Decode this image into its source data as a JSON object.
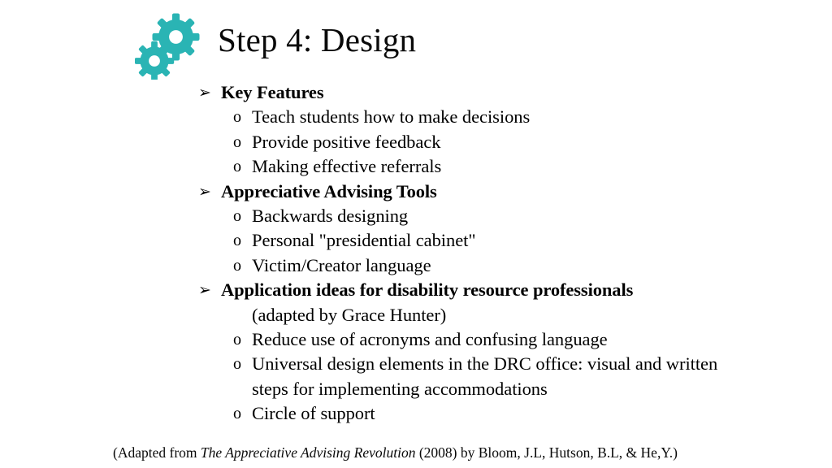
{
  "slide": {
    "background_color": "#ffffff",
    "text_color": "#000000",
    "accent_color": "#2ab4b4",
    "title": "Step 4: Design",
    "icon_name": "gears-icon"
  },
  "bullets": {
    "level1_glyph": "➢",
    "level2_glyph": "o"
  },
  "content": [
    {
      "level": 1,
      "text": "Key Features"
    },
    {
      "level": 2,
      "text": "Teach students how to make decisions"
    },
    {
      "level": 2,
      "text": "Provide positive feedback"
    },
    {
      "level": 2,
      "text": "Making effective referrals"
    },
    {
      "level": 1,
      "text": "Appreciative Advising Tools"
    },
    {
      "level": 2,
      "text": "Backwards designing"
    },
    {
      "level": 2,
      "text": "Personal \"presidential cabinet\""
    },
    {
      "level": 2,
      "text": "Victim/Creator language"
    },
    {
      "level": 1,
      "text": "Application ideas for disability resource professionals"
    },
    {
      "level": 2,
      "continuation": true,
      "text": "(adapted by Grace Hunter)"
    },
    {
      "level": 2,
      "text": "Reduce use of acronyms and confusing language"
    },
    {
      "level": 2,
      "text": "Universal design elements in the DRC office: visual and written"
    },
    {
      "level": 2,
      "continuation": true,
      "text": "steps for implementing accommodations"
    },
    {
      "level": 2,
      "text": "Circle of support"
    }
  ],
  "footer": {
    "prefix": "(Adapted from ",
    "title_italic": "The Appreciative Advising Revolution",
    "suffix": " (2008) by Bloom, J.L, Hutson, B.L, & He,Y.)"
  }
}
